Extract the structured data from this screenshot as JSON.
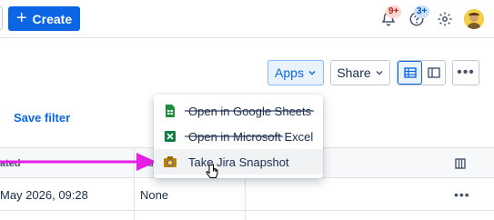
{
  "topbar": {
    "create_label": "Create",
    "notifications_badge": "9+",
    "help_badge": "3+"
  },
  "toolbar": {
    "apps_label": "Apps",
    "share_label": "Share",
    "more_label": "•••"
  },
  "save_filter_label": "Save filter",
  "table": {
    "columns": [
      "ated",
      "Du"
    ],
    "rows": [
      {
        "created": "May 2026, 09:28",
        "due": "None",
        "more": "•••"
      }
    ]
  },
  "apps_menu": {
    "items": [
      {
        "label": "Open in Google Sheets",
        "icon": "google-sheets-icon"
      },
      {
        "label": "Open in Microsoft Excel",
        "icon": "excel-icon"
      },
      {
        "label": "Take Jira Snapshot",
        "icon": "jira-snapshot-icon"
      }
    ]
  },
  "colors": {
    "accent": "#0c66e4",
    "annotation_arrow": "#e61ee6"
  }
}
